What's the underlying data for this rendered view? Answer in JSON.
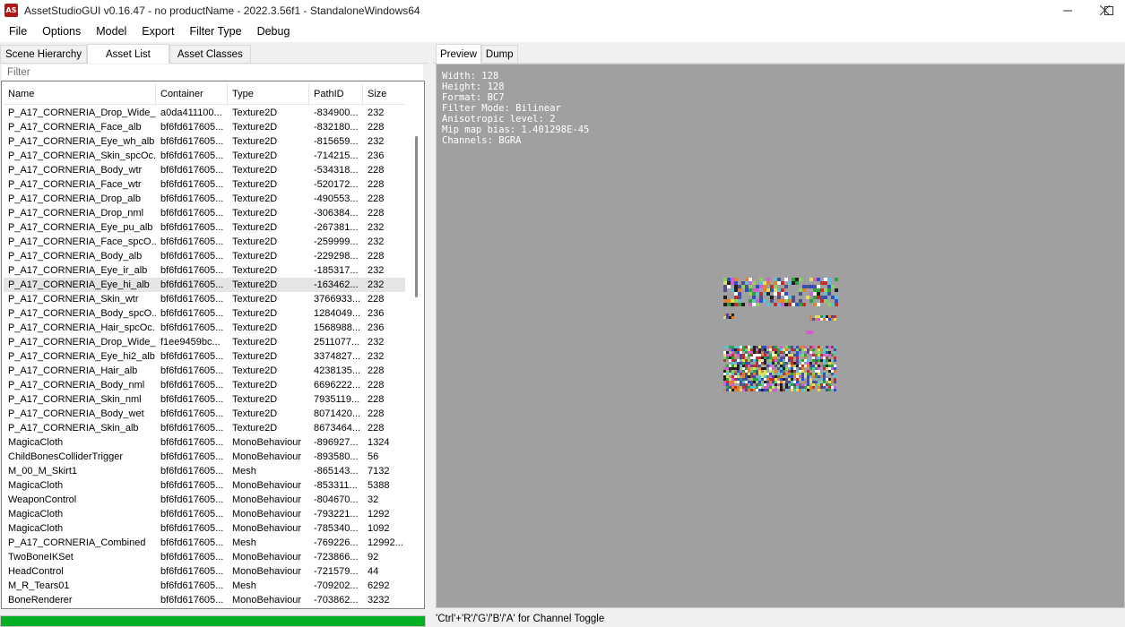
{
  "window": {
    "app_icon_text": "AS",
    "title": "AssetStudioGUI v0.16.47 - no productName - 2022.3.56f1 - StandaloneWindows64",
    "minimize_icon": "minimize-icon",
    "maximize_icon": "maximize-icon",
    "close_icon": "close-icon"
  },
  "menu": [
    "File",
    "Options",
    "Model",
    "Export",
    "Filter Type",
    "Debug"
  ],
  "left_tabs": [
    "Scene Hierarchy",
    "Asset List",
    "Asset Classes"
  ],
  "active_left_tab": 1,
  "filter_placeholder": "Filter",
  "columns": [
    "Name",
    "Container",
    "Type",
    "PathID",
    "Size"
  ],
  "rows": [
    [
      "P_A17_CORNERIA_Drop_Wide_...",
      "a0da411100...",
      "Texture2D",
      "-834900...",
      "232"
    ],
    [
      "P_A17_CORNERIA_Face_alb",
      "bf6fd617605...",
      "Texture2D",
      "-832180...",
      "228"
    ],
    [
      "P_A17_CORNERIA_Eye_wh_alb",
      "bf6fd617605...",
      "Texture2D",
      "-815659...",
      "232"
    ],
    [
      "P_A17_CORNERIA_Skin_spcOc...",
      "bf6fd617605...",
      "Texture2D",
      "-714215...",
      "236"
    ],
    [
      "P_A17_CORNERIA_Body_wtr",
      "bf6fd617605...",
      "Texture2D",
      "-534318...",
      "228"
    ],
    [
      "P_A17_CORNERIA_Face_wtr",
      "bf6fd617605...",
      "Texture2D",
      "-520172...",
      "228"
    ],
    [
      "P_A17_CORNERIA_Drop_alb",
      "bf6fd617605...",
      "Texture2D",
      "-490553...",
      "228"
    ],
    [
      "P_A17_CORNERIA_Drop_nml",
      "bf6fd617605...",
      "Texture2D",
      "-306384...",
      "228"
    ],
    [
      "P_A17_CORNERIA_Eye_pu_alb",
      "bf6fd617605...",
      "Texture2D",
      "-267381...",
      "232"
    ],
    [
      "P_A17_CORNERIA_Face_spcO...",
      "bf6fd617605...",
      "Texture2D",
      "-259999...",
      "232"
    ],
    [
      "P_A17_CORNERIA_Body_alb",
      "bf6fd617605...",
      "Texture2D",
      "-229298...",
      "228"
    ],
    [
      "P_A17_CORNERIA_Eye_ir_alb",
      "bf6fd617605...",
      "Texture2D",
      "-185317...",
      "232"
    ],
    [
      "P_A17_CORNERIA_Eye_hi_alb",
      "bf6fd617605...",
      "Texture2D",
      "-163462...",
      "232"
    ],
    [
      "P_A17_CORNERIA_Skin_wtr",
      "bf6fd617605...",
      "Texture2D",
      "3766933...",
      "228"
    ],
    [
      "P_A17_CORNERIA_Body_spcO...",
      "bf6fd617605...",
      "Texture2D",
      "1284049...",
      "236"
    ],
    [
      "P_A17_CORNERIA_Hair_spcOc...",
      "bf6fd617605...",
      "Texture2D",
      "1568988...",
      "236"
    ],
    [
      "P_A17_CORNERIA_Drop_Wide_...",
      "f1ee9459bc...",
      "Texture2D",
      "2511077...",
      "232"
    ],
    [
      "P_A17_CORNERIA_Eye_hi2_alb",
      "bf6fd617605...",
      "Texture2D",
      "3374827...",
      "232"
    ],
    [
      "P_A17_CORNERIA_Hair_alb",
      "bf6fd617605...",
      "Texture2D",
      "4238135...",
      "228"
    ],
    [
      "P_A17_CORNERIA_Body_nml",
      "bf6fd617605...",
      "Texture2D",
      "6696222...",
      "228"
    ],
    [
      "P_A17_CORNERIA_Skin_nml",
      "bf6fd617605...",
      "Texture2D",
      "7935119...",
      "228"
    ],
    [
      "P_A17_CORNERIA_Body_wet",
      "bf6fd617605...",
      "Texture2D",
      "8071420...",
      "228"
    ],
    [
      "P_A17_CORNERIA_Skin_alb",
      "bf6fd617605...",
      "Texture2D",
      "8673464...",
      "228"
    ],
    [
      "MagicaCloth",
      "bf6fd617605...",
      "MonoBehaviour",
      "-896927...",
      "1324"
    ],
    [
      "ChildBonesColliderTrigger",
      "bf6fd617605...",
      "MonoBehaviour",
      "-893580...",
      "56"
    ],
    [
      "M_00_M_Skirt1",
      "bf6fd617605...",
      "Mesh",
      "-865143...",
      "7132"
    ],
    [
      "MagicaCloth",
      "bf6fd617605...",
      "MonoBehaviour",
      "-853311...",
      "5388"
    ],
    [
      "WeaponControl",
      "bf6fd617605...",
      "MonoBehaviour",
      "-804670...",
      "32"
    ],
    [
      "MagicaCloth",
      "bf6fd617605...",
      "MonoBehaviour",
      "-793221...",
      "1292"
    ],
    [
      "MagicaCloth",
      "bf6fd617605...",
      "MonoBehaviour",
      "-785340...",
      "1092"
    ],
    [
      "P_A17_CORNERIA_Combined",
      "bf6fd617605...",
      "Mesh",
      "-769226...",
      "12992..."
    ],
    [
      "TwoBoneIKSet",
      "bf6fd617605...",
      "MonoBehaviour",
      "-723866...",
      "92"
    ],
    [
      "HeadControl",
      "bf6fd617605...",
      "MonoBehaviour",
      "-721579...",
      "44"
    ],
    [
      "M_R_Tears01",
      "bf6fd617605...",
      "Mesh",
      "-709202...",
      "6292"
    ],
    [
      "BoneRenderer",
      "bf6fd617605...",
      "MonoBehaviour",
      "-703862...",
      "3232"
    ]
  ],
  "selected_row": 12,
  "progress_fraction": 1.0,
  "right_tabs": [
    "Preview",
    "Dump"
  ],
  "active_right_tab": 0,
  "texture_info": [
    "Width: 128",
    "Height: 128",
    "Format: BC7",
    "Filter Mode: Bilinear",
    "Anisotropic level: 2",
    "Mip map bias: 1.401298E-45",
    "Channels: BGRA"
  ],
  "status_text": "'Ctrl'+'R'/'G'/'B'/'A' for Channel Toggle",
  "colors": {
    "progress": "#06b025",
    "preview_bg": "#a0a0a0",
    "selected_row": "#e5e5e5",
    "app_icon": "#b01818"
  }
}
